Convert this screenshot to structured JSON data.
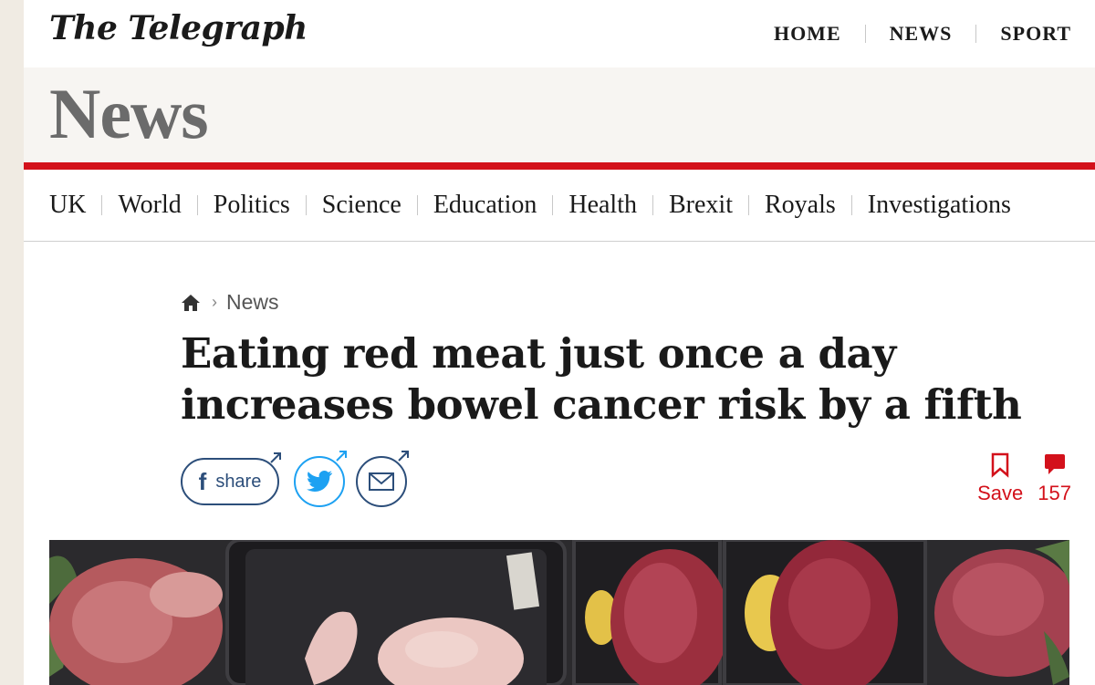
{
  "masthead": {
    "logo": "The Telegraph",
    "nav": [
      "HOME",
      "NEWS",
      "SPORT"
    ]
  },
  "section": {
    "title": "News"
  },
  "subnav": {
    "items": [
      "UK",
      "World",
      "Politics",
      "Science",
      "Education",
      "Health",
      "Brexit",
      "Royals",
      "Investigations"
    ]
  },
  "breadcrumb": {
    "home_icon": "home-icon",
    "current": "News"
  },
  "article": {
    "headline": "Eating red meat just once a day increases bowel cancer risk by a fifth"
  },
  "share": {
    "facebook_label": "share",
    "icons": [
      "facebook-icon",
      "twitter-icon",
      "email-icon"
    ]
  },
  "actions": {
    "save_label": "Save",
    "comment_count": "157"
  },
  "colors": {
    "accent_red": "#d3111b",
    "share_blue": "#2c4e7a",
    "twitter_blue": "#1da1f2",
    "section_bg": "#f7f5f2",
    "section_title": "#6b6b6b"
  }
}
